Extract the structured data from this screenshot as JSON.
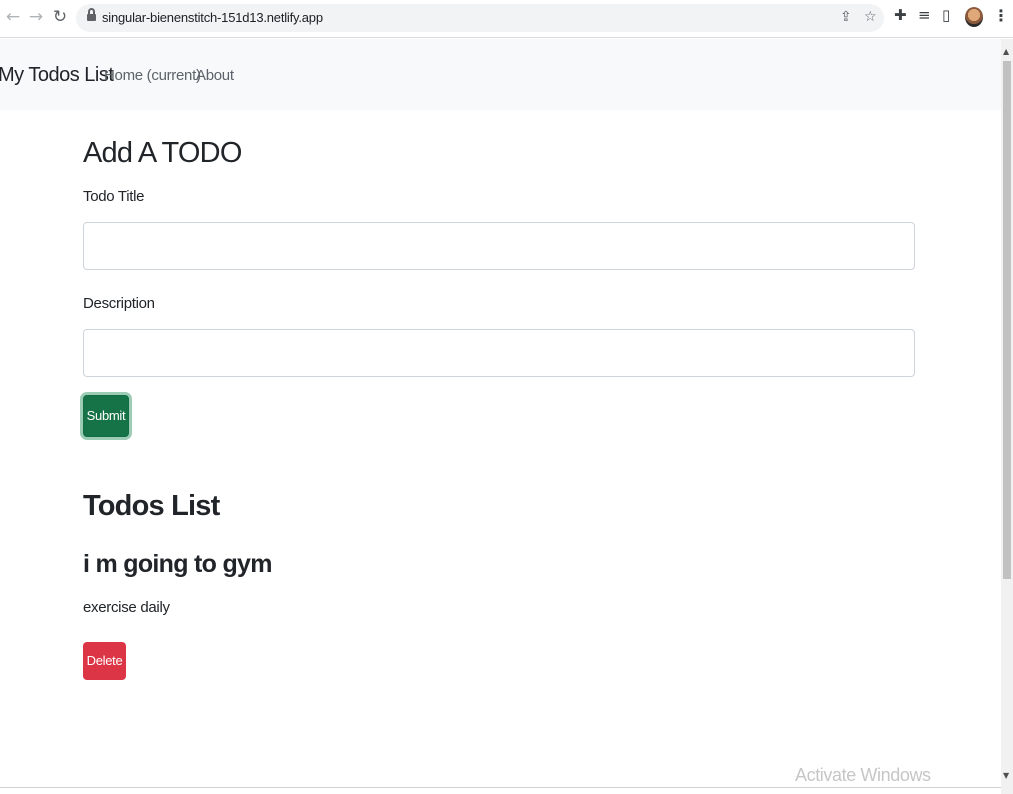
{
  "browser": {
    "url": "singular-bienenstitch-151d13.netlify.app"
  },
  "navbar": {
    "brand": "My Todos List",
    "links": [
      {
        "label": "Home (current)"
      },
      {
        "label": "About"
      }
    ]
  },
  "form": {
    "heading": "Add A TODO",
    "title_label": "Todo Title",
    "title_value": "",
    "description_label": "Description",
    "description_value": "",
    "submit_label": "Submit"
  },
  "todos": {
    "heading": "Todos List",
    "items": [
      {
        "title": "i m going to gym",
        "description": "exercise daily",
        "delete_label": "Delete"
      }
    ]
  },
  "watermark": "Activate Windows",
  "colors": {
    "submit": "#157347",
    "delete": "#dc3545",
    "navbar_bg": "#f8f9fa"
  }
}
